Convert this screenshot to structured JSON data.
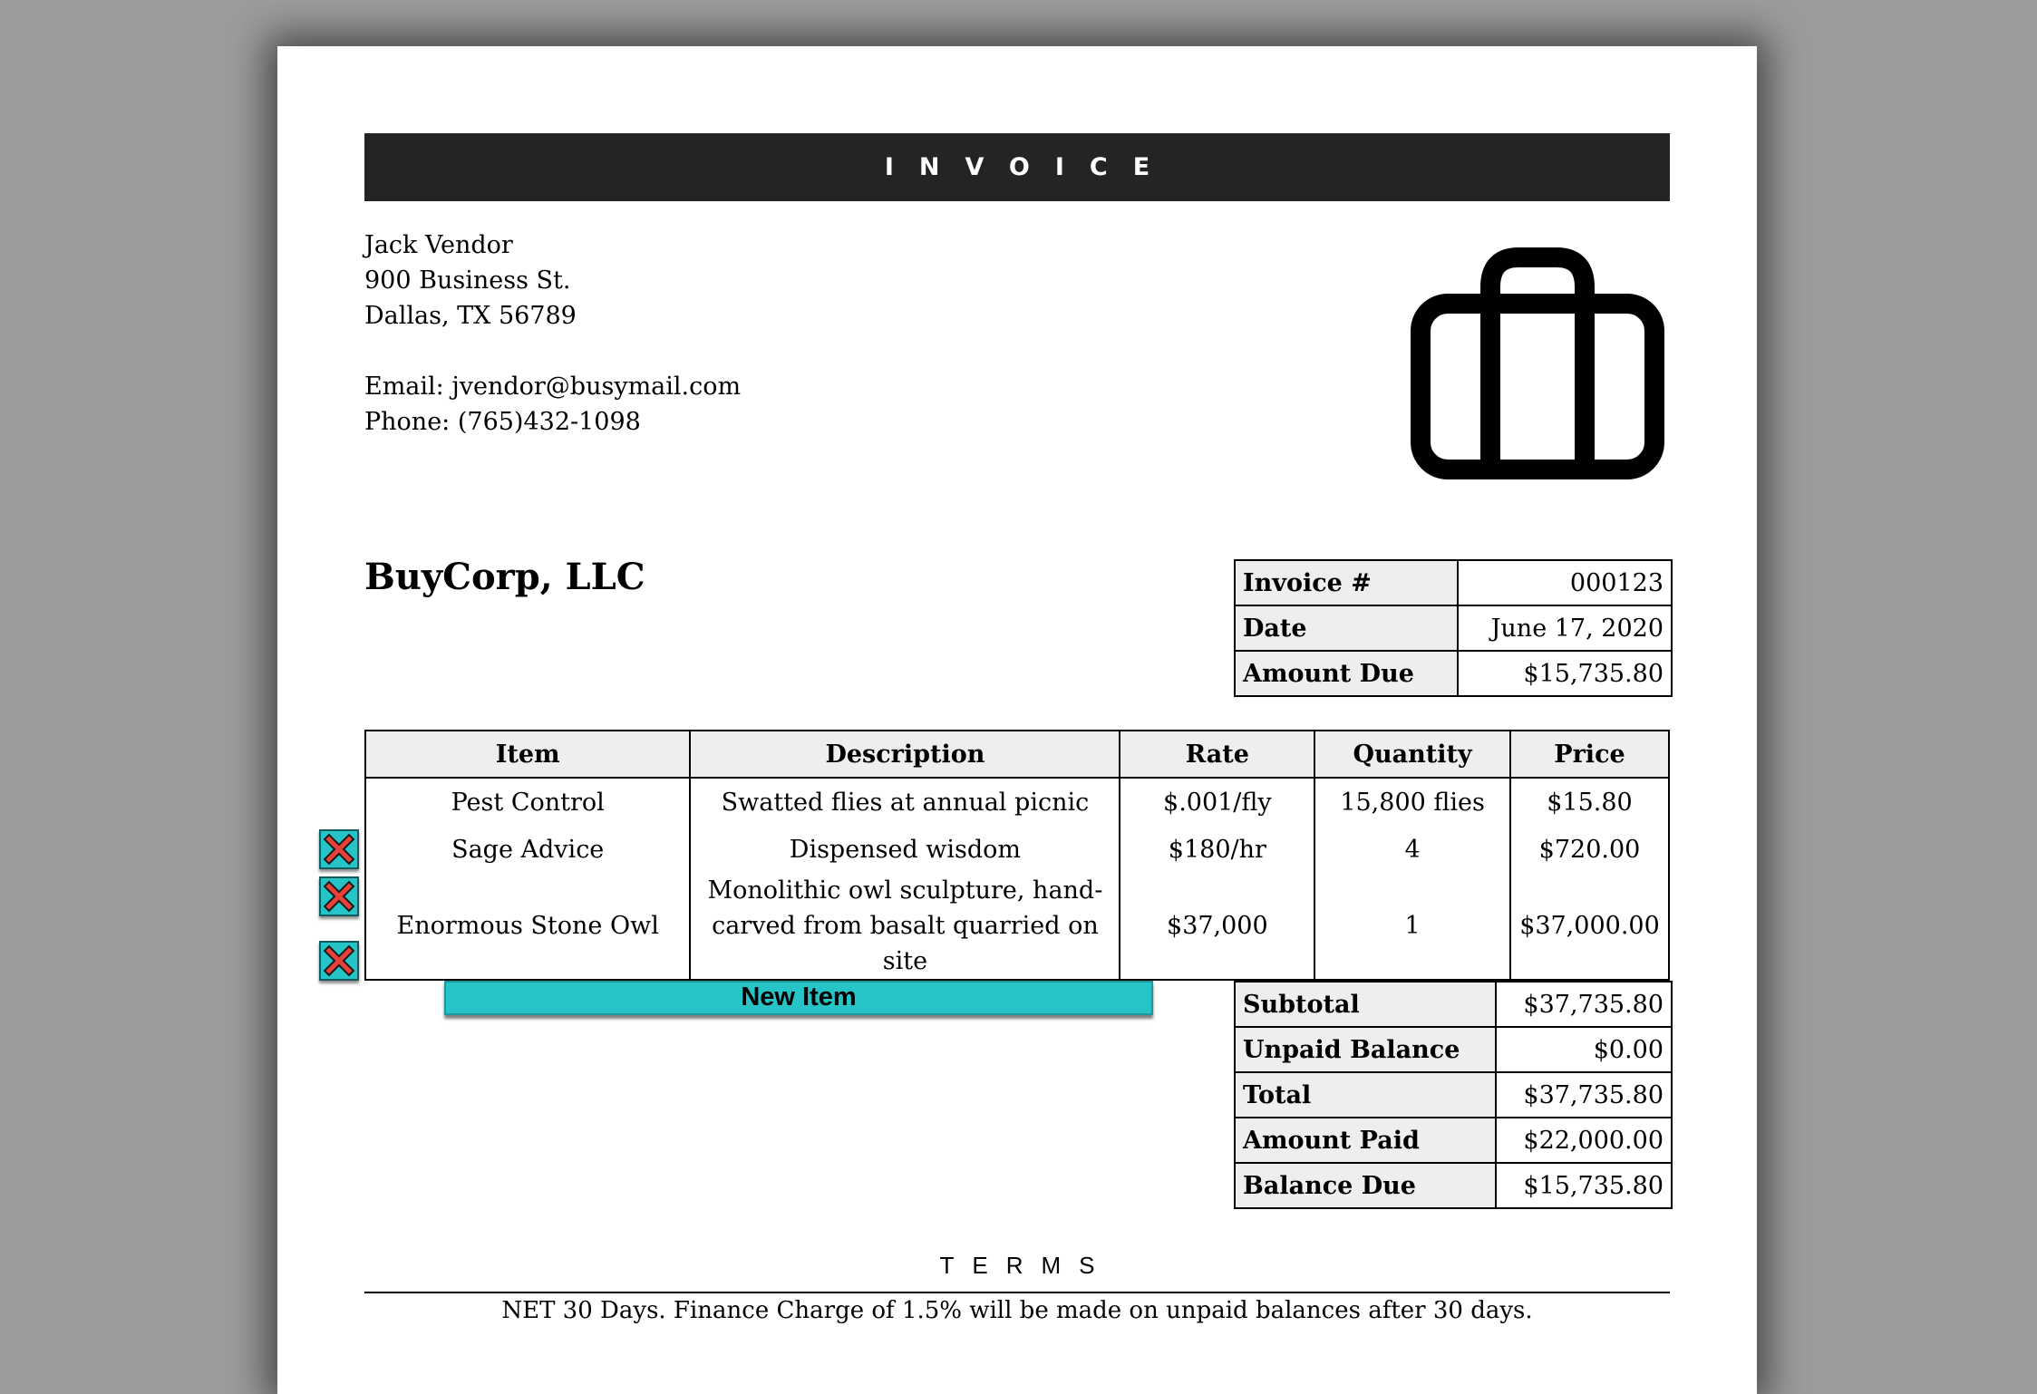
{
  "colors": {
    "page_background": "#9c9c9c",
    "title_bar": "#242424",
    "accent": "#26c4c6",
    "remove_icon": "#e8413a",
    "label_cell": "#eeeeee"
  },
  "invoice": {
    "title": "INVOICE"
  },
  "vendor": {
    "name": "Jack Vendor",
    "address_line1": "900 Business St.",
    "address_line2": "Dallas, TX 56789",
    "email": "Email: jvendor@busymail.com",
    "phone": "Phone: (765)432-1098"
  },
  "logo": {
    "icon": "briefcase-icon"
  },
  "customer": {
    "name": "BuyCorp, LLC"
  },
  "meta": [
    {
      "label": "Invoice #",
      "value": "000123"
    },
    {
      "label": "Date",
      "value": "June 17, 2020"
    },
    {
      "label": "Amount Due",
      "value": "$15,735.80"
    }
  ],
  "items_table": {
    "headers": [
      "Item",
      "Description",
      "Rate",
      "Quantity",
      "Price"
    ],
    "rows": [
      {
        "item": "Pest Control",
        "description": "Swatted flies at annual picnic",
        "rate": "$.001/fly",
        "quantity": "15,800 flies",
        "price": "$15.80"
      },
      {
        "item": "Sage Advice",
        "description": "Dispensed wisdom",
        "rate": "$180/hr",
        "quantity": "4",
        "price": "$720.00"
      },
      {
        "item": "Enormous Stone Owl",
        "description": "Monolithic owl sculpture, hand-carved from basalt quarried on site",
        "rate": "$37,000",
        "quantity": "1",
        "price": "$37,000.00"
      }
    ],
    "remove_icon": "close-x-icon"
  },
  "new_item_label": "New Item",
  "totals": [
    {
      "label": "Subtotal",
      "value": "$37,735.80"
    },
    {
      "label": "Unpaid Balance",
      "value": "$0.00"
    },
    {
      "label": "Total",
      "value": "$37,735.80"
    },
    {
      "label": "Amount Paid",
      "value": "$22,000.00"
    },
    {
      "label": "Balance Due",
      "value": "$15,735.80"
    }
  ],
  "terms": {
    "title": "TERMS",
    "text": "NET 30 Days. Finance Charge of 1.5% will be made on unpaid balances after 30 days."
  }
}
